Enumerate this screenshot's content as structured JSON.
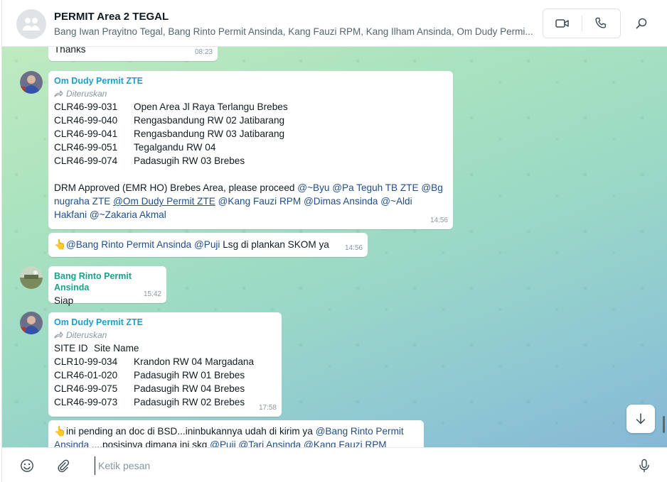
{
  "header": {
    "title": "PERMIT Area 2 TEGAL",
    "members": "Bang Iwan Prayitno Tegal, Bang Rinto Permit Ansinda, Kang Fauzi RPM, Kang Ilham Ansinda, Om Dudy Permi..."
  },
  "colors": {
    "dudy": "#1e9fc9",
    "rinto": "#1aa18a",
    "mention": "#1f4d8a"
  },
  "messages": {
    "m0": {
      "text": "Thanks",
      "time": "08:23"
    },
    "m1": {
      "sender": "Om Dudy Permit ZTE",
      "forwarded": "Diteruskan",
      "rows": [
        {
          "id": "CLR46-99-031",
          "name": "Open Area Jl Raya Terlangu Brebes"
        },
        {
          "id": "CLR46-99-040",
          "name": "Rengasbandung RW 02 Jatibarang"
        },
        {
          "id": "CLR46-99-041",
          "name": "Rengasbandung RW 03 Jatibarang"
        },
        {
          "id": "CLR46-99-051",
          "name": "Tegalgandu RW 04"
        },
        {
          "id": "CLR46-99-074",
          "name": "Padasugih RW 03 Brebes"
        }
      ],
      "body_prefix": "DRM Approved (EMR HO) Brebes Area, please proceed ",
      "mentions": [
        "@~Byu",
        "@Pa Teguh TB ZTE",
        "@Bg nugraha ZTE",
        "@Om Dudy Permit ZTE",
        "@Kang Fauzi RPM",
        "@Dimas Ansinda",
        "@~Aldi Hakfani",
        "@~Zakaria Akmal"
      ],
      "time": "14:56"
    },
    "m2": {
      "emoji": "👆",
      "mentions": [
        "@Bang Rinto Permit Ansinda",
        "@Puji"
      ],
      "text": " Lsg di plankan SKOM ya",
      "time": "14:56"
    },
    "m3": {
      "sender": "Bang Rinto Permit Ansinda",
      "text": "Siap",
      "time": "15:42"
    },
    "m4": {
      "sender": "Om Dudy Permit ZTE",
      "forwarded": "Diteruskan",
      "header_row": {
        "id": "SITE ID",
        "name": "Site Name"
      },
      "rows": [
        {
          "id": "CLR10-99-034",
          "name": "Krandon RW 04 Margadana"
        },
        {
          "id": "CLR46-01-020",
          "name": "Padasugih RW 01 Brebes"
        },
        {
          "id": "CLR46-99-075",
          "name": "Padasugih RW 04 Brebes"
        },
        {
          "id": "CLR46-99-073",
          "name": "Padasugih RW 02 Brebes"
        }
      ],
      "time": "17:58"
    },
    "m5": {
      "emoji": "👆",
      "text": "ini pending an doc di BSD...ininbukannya udah di kirim ya ",
      "mention1": "@Bang Rinto Permit Ansinda",
      "text2": " ....posisinya dimana ini skg ",
      "mentions2": [
        "@Puji",
        "@Tari Ansinda",
        "@Kang Fauzi RPM"
      ]
    }
  },
  "composer": {
    "placeholder": "Ketik pesan"
  }
}
